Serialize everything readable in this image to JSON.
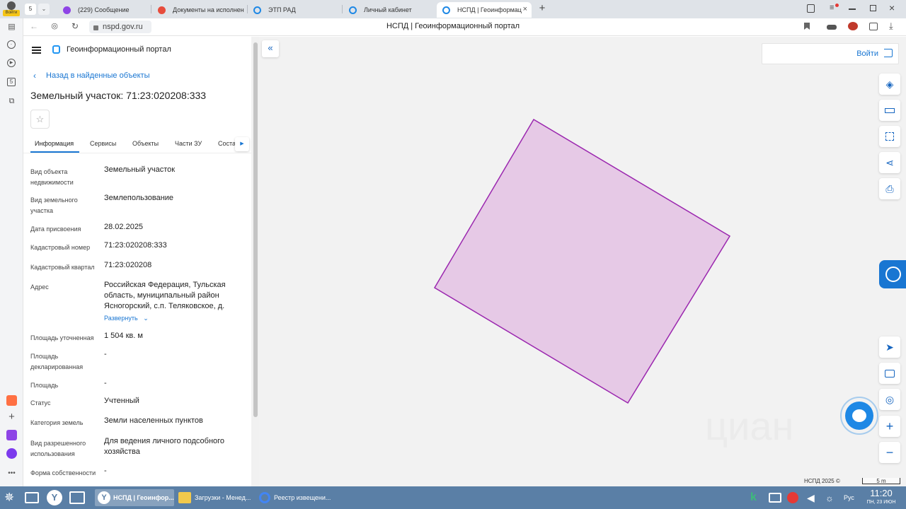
{
  "browser": {
    "tab_count": "5",
    "profile_label": "Войти",
    "tabs": [
      {
        "label": "(229) Сообщение",
        "color": "#8e44e6"
      },
      {
        "label": "Документы на исполнен",
        "color": "#e74c3c"
      },
      {
        "label": "ЭТП РАД",
        "color": "#1e88e5"
      },
      {
        "label": "Личный кабинет",
        "color": "#1e88e5"
      },
      {
        "label": "НСПД | Геоинформац",
        "color": "#1e88e5"
      }
    ],
    "new_tab": "+",
    "url": "nspd.gov.ru",
    "page_title": "НСПД | Геоинформационный портал"
  },
  "panel": {
    "portal_title": "Геоинформационный портал",
    "back_link": "Назад в найденные объекты",
    "object_title": "Земельный участок: 71:23:020208:333",
    "tabs": [
      "Информация",
      "Сервисы",
      "Объекты",
      "Части ЗУ",
      "Соста"
    ],
    "active_tab": "Информация",
    "fields": [
      {
        "label": "Вид объекта недвижимости",
        "value": "Земельный участок"
      },
      {
        "label": "Вид земельного участка",
        "value": "Землепользование"
      },
      {
        "label": "Дата присвоения",
        "value": "28.02.2025"
      },
      {
        "label": "Кадастровый номер",
        "value": "71:23:020208:333"
      },
      {
        "label": "Кадастровый квартал",
        "value": "71:23:020208"
      },
      {
        "label": "Адрес",
        "value": "Российская Федерация, Тульская область, муниципальный район Ясногорский, с.п. Теляковское, д."
      },
      {
        "label": "Площадь уточненная",
        "value": "1 504 кв. м"
      },
      {
        "label": "Площадь декларированная",
        "value": "-"
      },
      {
        "label": "Площадь",
        "value": "-"
      },
      {
        "label": "Статус",
        "value": "Учтенный"
      },
      {
        "label": "Категория земель",
        "value": "Земли населенных пунктов"
      },
      {
        "label": "Вид разрешенного использования",
        "value": "Для ведения личного подсобного хозяйства"
      },
      {
        "label": "Форма собственности",
        "value": "-"
      }
    ],
    "expand_link": "Развернуть"
  },
  "map": {
    "login_label": "Войти",
    "copyright": "НСПД 2025 ©",
    "scale": "5 m",
    "watermark": "циан",
    "parcel_fill": "#e6c9e6",
    "parcel_stroke": "#9b27af"
  },
  "taskbar": {
    "items": [
      "НСПД | Геоинфор...",
      "Загрузки - Менед...",
      "Реестр извещени..."
    ],
    "lang": "Рус",
    "time": "11:20",
    "date": "ПН, 23 ИЮН"
  }
}
